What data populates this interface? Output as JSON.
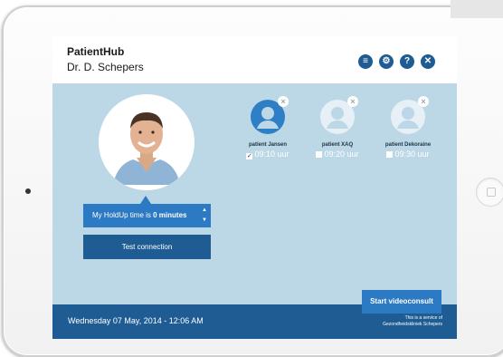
{
  "app": {
    "title": "PatientHub",
    "doctor": "Dr. D. Schepers"
  },
  "header_icons": [
    {
      "name": "menu-icon",
      "glyph": "≡"
    },
    {
      "name": "gear-icon",
      "glyph": "⚙"
    },
    {
      "name": "help-icon",
      "glyph": "?"
    },
    {
      "name": "close-icon",
      "glyph": "✕"
    }
  ],
  "holdup": {
    "prefix": "My HoldUp time is ",
    "value": "0 minutes"
  },
  "test_connection_label": "Test connection",
  "patients": [
    {
      "name": "patient Jansen",
      "time": "09:10 uur",
      "checked": true,
      "check_mark": "✓"
    },
    {
      "name": "patient XAQ",
      "time": "09:20 uur",
      "checked": false,
      "check_mark": ""
    },
    {
      "name": "patient Dekoraine",
      "time": "09:30 uur",
      "checked": false,
      "check_mark": ""
    }
  ],
  "start_button_label": "Start videoconsult",
  "footer": {
    "date": "Wednesday 07 May, 2014 - 12:06 AM",
    "service_line1": "This is a service of",
    "service_line2": "Gezondheidskliniek Schepers"
  },
  "colors": {
    "screen_bg": "#bcd7e6",
    "dark_blue": "#1e5c93",
    "accent_blue": "#2c7ac3",
    "avatar_active": "#2f7fc6",
    "avatar_inactive": "#e6f0f6"
  }
}
